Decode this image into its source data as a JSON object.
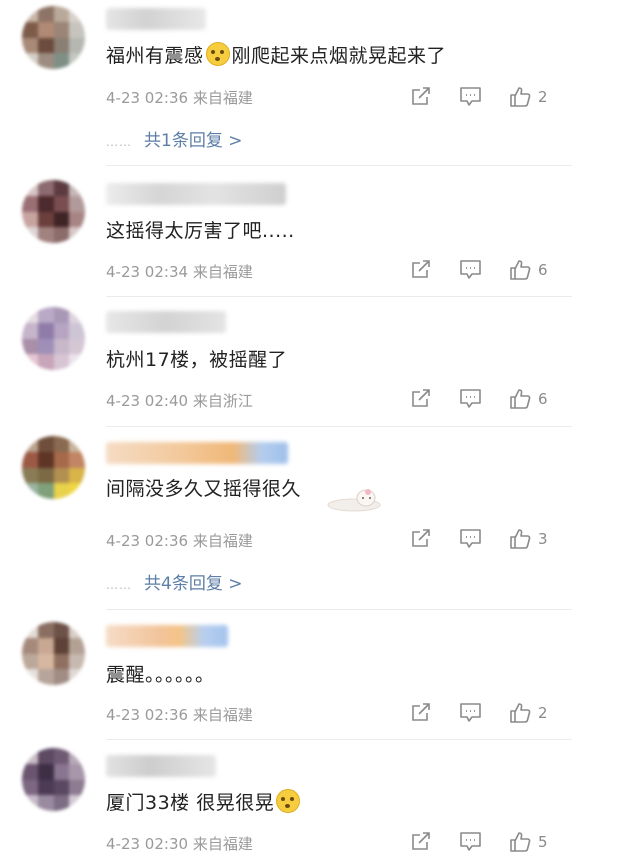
{
  "comments": [
    {
      "text_before": "福州有震感",
      "text_after": "刚爬起来点烟就晃起来了",
      "emoji": "face-with-open-mouth-emoji",
      "date": "4-23 02:36",
      "location": "来自福建",
      "likes": "2",
      "replies": "共1条回复 >"
    },
    {
      "text": "这摇得太厉害了吧.....",
      "date": "4-23 02:34",
      "location": "来自福建",
      "likes": "6"
    },
    {
      "text": "杭州17楼，被摇醒了",
      "date": "4-23 02:40",
      "location": "来自浙江",
      "likes": "6"
    },
    {
      "text": "间隔没多久又摇得很久",
      "date": "4-23 02:36",
      "location": "来自福建",
      "likes": "3",
      "replies": "共4条回复 >"
    },
    {
      "text": "震醒。。。。。。",
      "date": "4-23 02:36",
      "location": "来自福建",
      "likes": "2"
    },
    {
      "text_before": "厦门33楼 很晃很晃",
      "emoji": "dizzy-face-emoji",
      "date": "4-23 02:30",
      "location": "来自福建",
      "likes": "5"
    }
  ],
  "reply_dots": "……",
  "icons": {
    "repost": "repost-icon",
    "comment": "comment-icon",
    "like": "thumbs-up-icon"
  },
  "colors": {
    "text": "#222222",
    "meta": "#9a9a9a",
    "replies": "#5d7ea6",
    "divider": "#ebebeb",
    "icon": "#8a8a8a"
  }
}
